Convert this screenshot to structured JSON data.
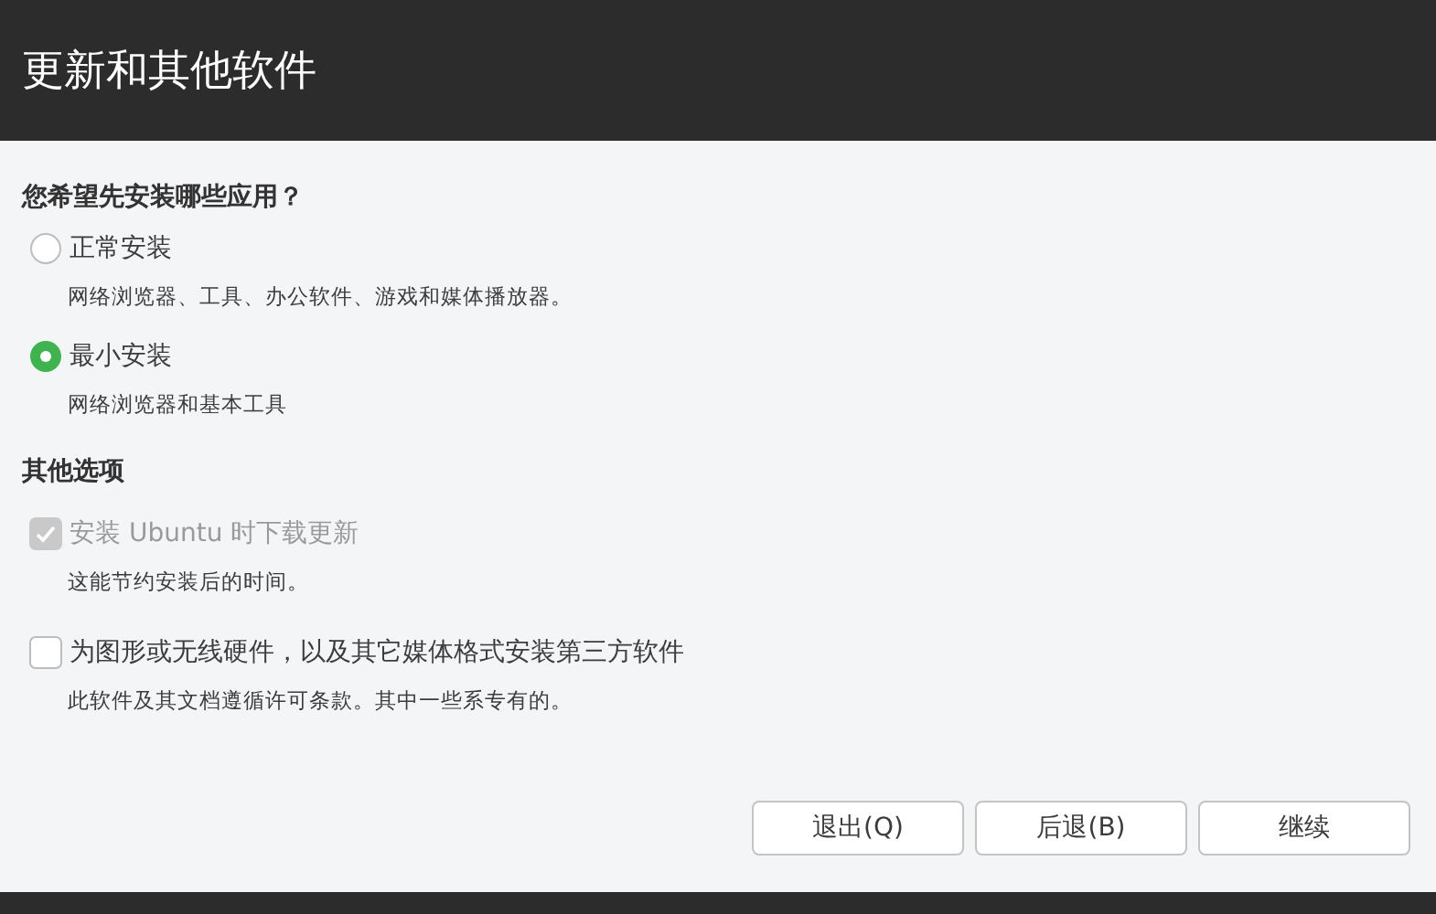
{
  "window": {
    "title": "更新和其他软件"
  },
  "question": "您希望先安装哪些应用？",
  "install_options": [
    {
      "label": "正常安装",
      "description": "网络浏览器、工具、办公软件、游戏和媒体播放器。",
      "selected": false
    },
    {
      "label": "最小安装",
      "description": "网络浏览器和基本工具",
      "selected": true
    }
  ],
  "other_heading": "其他选项",
  "other_options": [
    {
      "label": "安装 Ubuntu 时下载更新",
      "description": "这能节约安装后的时间。",
      "checked": true,
      "disabled": true
    },
    {
      "label": "为图形或无线硬件，以及其它媒体格式安装第三方软件",
      "description": "此软件及其文档遵循许可条款。其中一些系专有的。",
      "checked": false,
      "disabled": false
    }
  ],
  "buttons": [
    "退出(Q)",
    "后退(B)",
    "继续"
  ]
}
